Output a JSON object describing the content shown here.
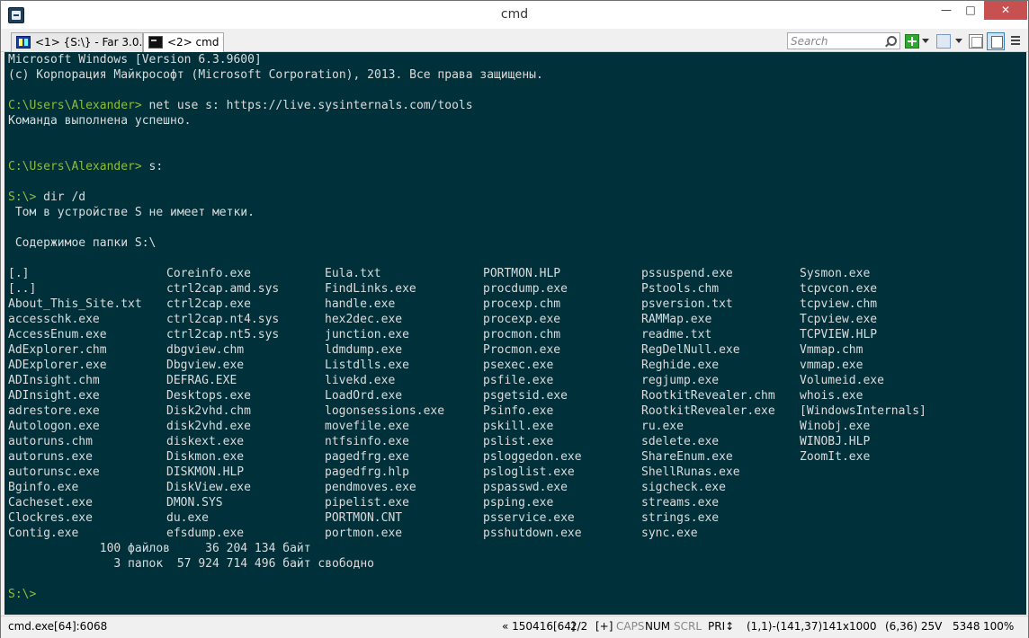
{
  "window": {
    "title": "cmd",
    "minimize": "—",
    "maximize": "□",
    "close": "✕"
  },
  "tabs": [
    {
      "label": "<1> {S:\\} - Far 3.0...",
      "icon": "far-icon",
      "active": false
    },
    {
      "label": "<2> cmd",
      "icon": "cmd-icon",
      "active": true
    }
  ],
  "toolbar": {
    "search_placeholder": "Search",
    "icons": [
      "search-icon",
      "plus-icon",
      "dropdown-arrow",
      "settings-icon",
      "dropdown-arrow",
      "panel-icon",
      "layout-icon",
      "menu-icon"
    ]
  },
  "colors": {
    "console_bg": "#00303a",
    "console_text": "#dcdcdc",
    "prompt": "#8fbc3a"
  },
  "console": {
    "header": [
      "Microsoft Windows [Version 6.3.9600]",
      "(c) Корпорация Майкрософт (Microsoft Corporation), 2013. Все права защищены."
    ],
    "cmd1_prompt": "C:\\Users\\Alexander>",
    "cmd1_command": " net use s: https://live.sysinternals.com/tools",
    "cmd1_result": "Команда выполнена успешно.",
    "cmd2_prompt": "C:\\Users\\Alexander>",
    "cmd2_command": " s:",
    "cmd3_prompt": "S:\\>",
    "cmd3_command": " dir /d",
    "volume_line": " Том в устройстве S не имеет метки.",
    "contents_line": " Содержимое папки S:\\",
    "listing_columns": [
      [
        "[.]",
        "[..]",
        "About_This_Site.txt",
        "accesschk.exe",
        "AccessEnum.exe",
        "AdExplorer.chm",
        "ADExplorer.exe",
        "ADInsight.chm",
        "ADInsight.exe",
        "adrestore.exe",
        "Autologon.exe",
        "autoruns.chm",
        "autoruns.exe",
        "autorunsc.exe",
        "Bginfo.exe",
        "Cacheset.exe",
        "Clockres.exe",
        "Contig.exe"
      ],
      [
        "Coreinfo.exe",
        "ctrl2cap.amd.sys",
        "ctrl2cap.exe",
        "ctrl2cap.nt4.sys",
        "ctrl2cap.nt5.sys",
        "dbgview.chm",
        "Dbgview.exe",
        "DEFRAG.EXE",
        "Desktops.exe",
        "Disk2vhd.chm",
        "disk2vhd.exe",
        "diskext.exe",
        "Diskmon.exe",
        "DISKMON.HLP",
        "DiskView.exe",
        "DMON.SYS",
        "du.exe",
        "efsdump.exe"
      ],
      [
        "Eula.txt",
        "FindLinks.exe",
        "handle.exe",
        "hex2dec.exe",
        "junction.exe",
        "ldmdump.exe",
        "Listdlls.exe",
        "livekd.exe",
        "LoadOrd.exe",
        "logonsessions.exe",
        "movefile.exe",
        "ntfsinfo.exe",
        "pagedfrg.exe",
        "pagedfrg.hlp",
        "pendmoves.exe",
        "pipelist.exe",
        "PORTMON.CNT",
        "portmon.exe"
      ],
      [
        "PORTMON.HLP",
        "procdump.exe",
        "procexp.chm",
        "procexp.exe",
        "procmon.chm",
        "Procmon.exe",
        "psexec.exe",
        "psfile.exe",
        "psgetsid.exe",
        "Psinfo.exe",
        "pskill.exe",
        "pslist.exe",
        "psloggedon.exe",
        "psloglist.exe",
        "pspasswd.exe",
        "psping.exe",
        "psservice.exe",
        "psshutdown.exe"
      ],
      [
        "pssuspend.exe",
        "Pstools.chm",
        "psversion.txt",
        "RAMMap.exe",
        "readme.txt",
        "RegDelNull.exe",
        "Reghide.exe",
        "regjump.exe",
        "RootkitRevealer.chm",
        "RootkitRevealer.exe",
        "ru.exe",
        "sdelete.exe",
        "ShareEnum.exe",
        "ShellRunas.exe",
        "sigcheck.exe",
        "streams.exe",
        "strings.exe",
        "sync.exe"
      ],
      [
        "Sysmon.exe",
        "tcpvcon.exe",
        "tcpview.chm",
        "Tcpview.exe",
        "TCPVIEW.HLP",
        "Vmmap.chm",
        "vmmap.exe",
        "Volumeid.exe",
        "whois.exe",
        "[WindowsInternals]",
        "Winobj.exe",
        "WINOBJ.HLP",
        "ZoomIt.exe"
      ]
    ],
    "summary_files": "             100 файлов     36 204 134 байт",
    "summary_dirs": "               3 папок  57 924 714 496 байт свободно",
    "final_prompt": "S:\\>"
  },
  "statusbar": {
    "process": "cmd.exe[64]:6068",
    "buffer": "« 150416[64]",
    "page": "2/2",
    "plus": "[+]",
    "caps": "CAPS",
    "num": "NUM",
    "scrl": "SCRL",
    "pri": "PRI↕",
    "coords": "(1,1)-(141,37)",
    "size": "141x1000",
    "cursor": "(6,36) 25V",
    "pid": "5348",
    "zoom": "100%"
  }
}
